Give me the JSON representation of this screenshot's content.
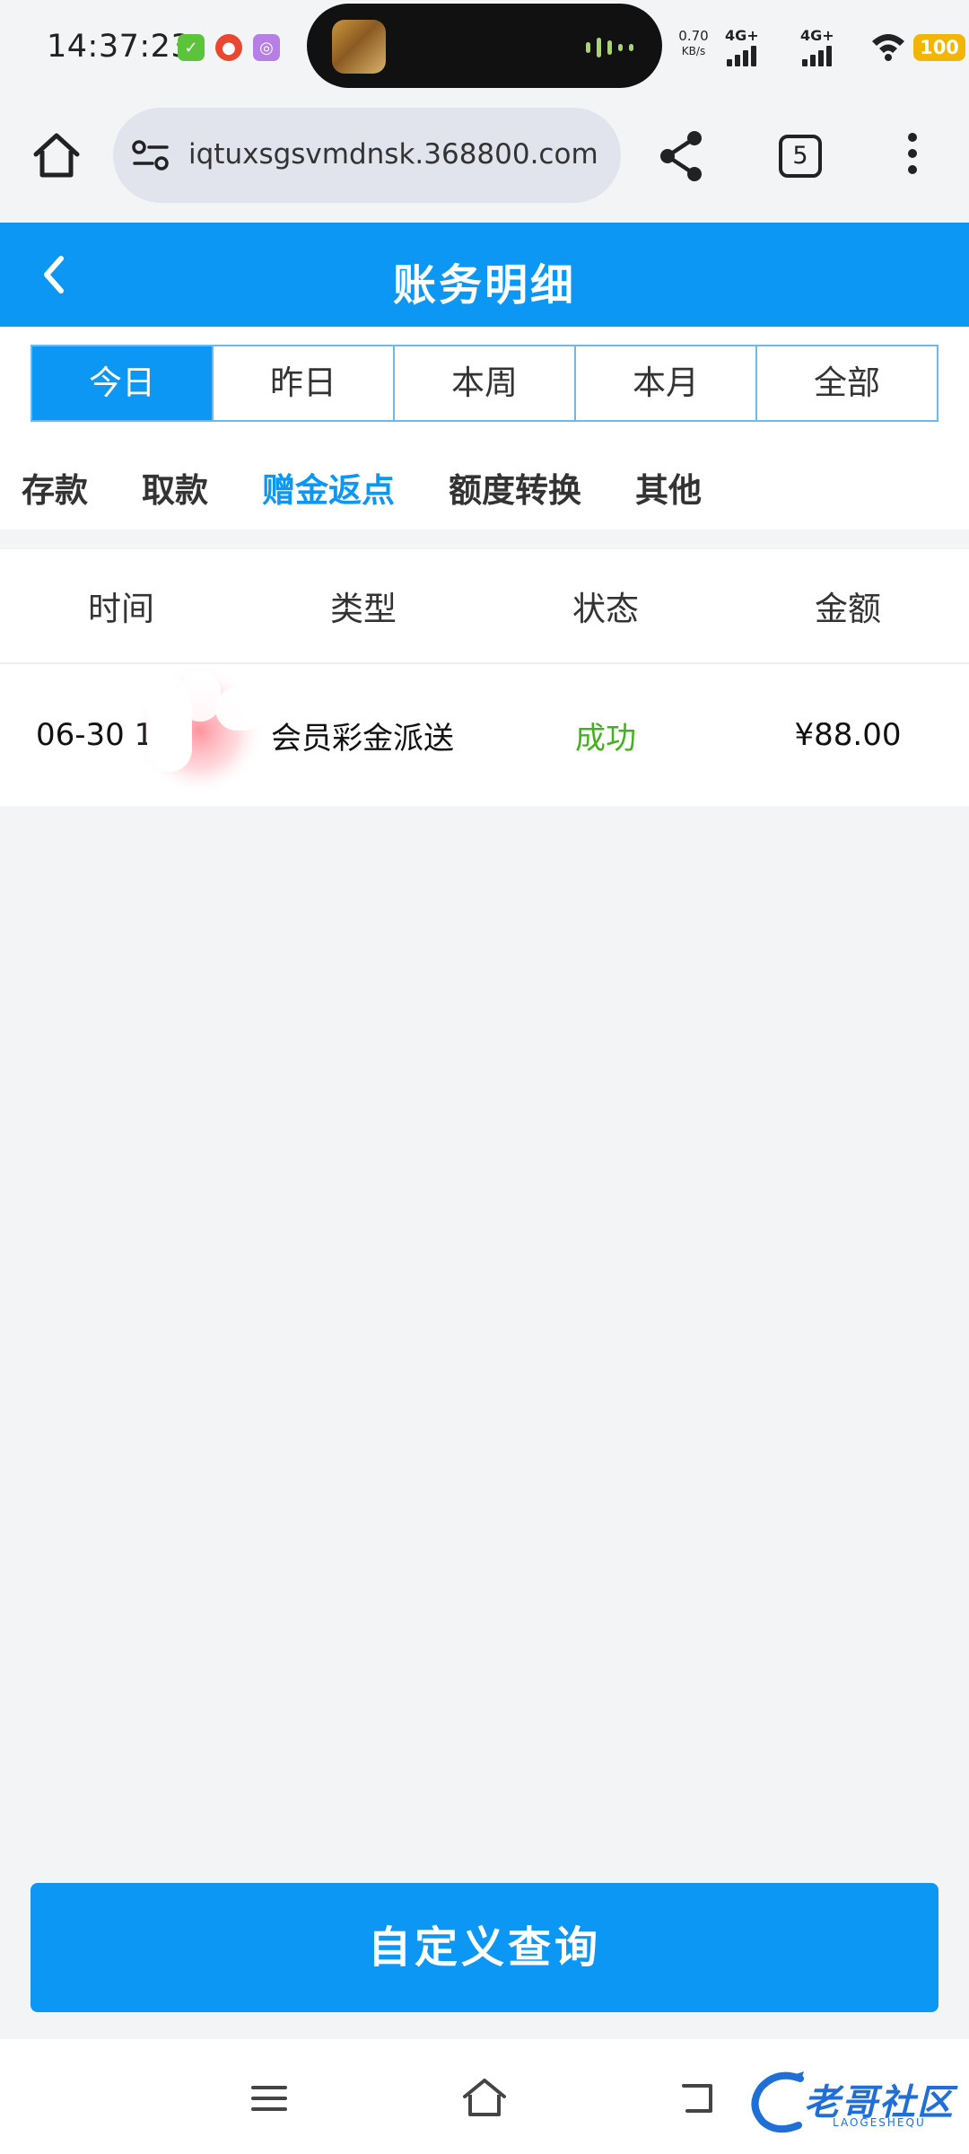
{
  "status_bar": {
    "time": "14:37:23",
    "app_icons": [
      "wechat-icon",
      "taobao-icon",
      "app-icon"
    ],
    "net_speed_value": "0.70",
    "net_speed_unit": "KB/s",
    "signal_1_label": "4G+",
    "signal_2_label": "4G+",
    "battery": "100"
  },
  "browser": {
    "url": "iqtuxsgsvmdnsk.368800.com",
    "tab_count": "5"
  },
  "header": {
    "title": "账务明细"
  },
  "period_tabs": [
    {
      "label": "今日",
      "active": true
    },
    {
      "label": "昨日",
      "active": false
    },
    {
      "label": "本周",
      "active": false
    },
    {
      "label": "本月",
      "active": false
    },
    {
      "label": "全部",
      "active": false
    }
  ],
  "category_tabs": [
    {
      "label": "存款",
      "active": false
    },
    {
      "label": "取款",
      "active": false
    },
    {
      "label": "赠金返点",
      "active": true
    },
    {
      "label": "额度转换",
      "active": false
    },
    {
      "label": "其他",
      "active": false
    }
  ],
  "table": {
    "columns": [
      "时间",
      "类型",
      "状态",
      "金额"
    ],
    "rows": [
      {
        "time": "06-30 1",
        "type": "会员彩金派送",
        "status": "成功",
        "amount": "¥88.00"
      }
    ]
  },
  "actions": {
    "custom_query_label": "自定义查询"
  },
  "watermark": {
    "text": "老哥社区",
    "sub": "LAOGESHEQU"
  },
  "colors": {
    "primary": "#0c97f4",
    "success": "#45b021",
    "background": "#f3f4f6",
    "battery": "#f2b500"
  }
}
